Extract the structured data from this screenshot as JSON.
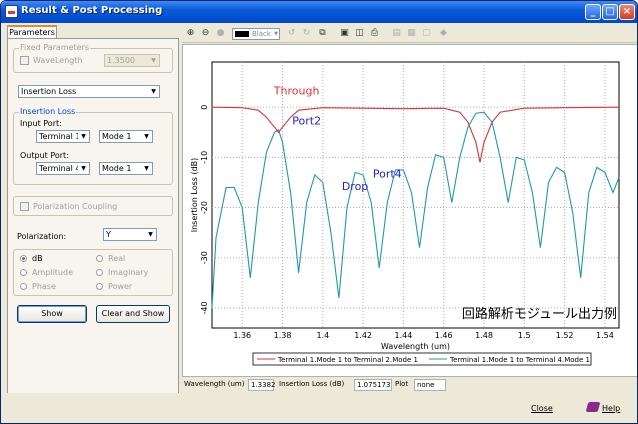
{
  "window": {
    "title": "Result & Post Processing",
    "controls": [
      "_",
      "□",
      "×"
    ]
  },
  "tabs": [
    "Parameters"
  ],
  "fixed_parameters": {
    "group_label": "Fixed Parameters",
    "wavelength_label": "WaveLength",
    "wavelength_value": "1.3500",
    "result_type": "Insertion Loss"
  },
  "insertion_loss": {
    "group_label": "Insertion Loss",
    "input_port_label": "Input Port:",
    "input_terminal": "Terminal 1",
    "input_mode": "Mode 1",
    "output_port_label": "Output Port:",
    "output_terminal": "Terminal 4",
    "output_mode": "Mode 1"
  },
  "polarization_coupling_label": "Polarization Coupling",
  "polarization": {
    "label": "Polarization:",
    "value": "Y"
  },
  "units": {
    "left": [
      "dB",
      "Amplitude",
      "Phase"
    ],
    "right": [
      "Real",
      "Imaginary",
      "Power"
    ],
    "selected": "dB"
  },
  "buttons": {
    "show": "Show",
    "clear_show": "Clear and Show",
    "close": "Close",
    "help": "Help"
  },
  "toolbar": {
    "color_label": "Black"
  },
  "status": {
    "wavelength_label": "Wavelength (um)",
    "wavelength_value": "1.3382",
    "loss_label": "Insertion Loss (dB)",
    "loss_value": "1.075173",
    "plot_label": "Plot",
    "plot_value": "none"
  },
  "colors": {
    "through": "#dd3333",
    "drop": "#1f9aa8",
    "label_blue": "#2222cc",
    "accent": "#0a5ad8"
  },
  "chart_data": {
    "type": "line",
    "xlabel": "Wavelength (um)",
    "ylabel": "Insertion Loss (dB)",
    "xlim": [
      1.345,
      1.547
    ],
    "ylim": [
      -44,
      9
    ],
    "xticks": [
      1.36,
      1.38,
      1.4,
      1.42,
      1.44,
      1.46,
      1.48,
      1.5,
      1.52,
      1.54
    ],
    "yticks": [
      0,
      -10,
      -20,
      -30,
      -40
    ],
    "grid": true,
    "legend_position": "bottom",
    "annotations": [
      "Through",
      "Port2",
      "Port4",
      "Drop",
      "回路解析モジュール出力例"
    ],
    "series": [
      {
        "name": "Terminal 1.Mode 1 to Terminal 2.Mode 1",
        "color": "#dd3333",
        "x": [
          1.345,
          1.36,
          1.368,
          1.372,
          1.376,
          1.378,
          1.38,
          1.384,
          1.388,
          1.4,
          1.42,
          1.44,
          1.46,
          1.468,
          1.472,
          1.476,
          1.478,
          1.48,
          1.484,
          1.488,
          1.5,
          1.52,
          1.547
        ],
        "y": [
          0,
          -0.1,
          -0.6,
          -2,
          -4,
          -5,
          -4,
          -2,
          -0.6,
          -0.1,
          -0.2,
          -0.3,
          -0.2,
          -1,
          -3,
          -7,
          -11,
          -7,
          -3,
          -1,
          -0.2,
          -0.1,
          0
        ]
      },
      {
        "name": "Terminal 1.Mode 1 to Terminal 4.Mode 1",
        "color": "#1f9aa8",
        "x": [
          1.345,
          1.347,
          1.352,
          1.356,
          1.36,
          1.364,
          1.368,
          1.372,
          1.376,
          1.378,
          1.38,
          1.384,
          1.388,
          1.392,
          1.396,
          1.4,
          1.404,
          1.408,
          1.412,
          1.416,
          1.42,
          1.424,
          1.428,
          1.432,
          1.436,
          1.44,
          1.444,
          1.448,
          1.452,
          1.456,
          1.46,
          1.464,
          1.468,
          1.472,
          1.476,
          1.48,
          1.484,
          1.488,
          1.492,
          1.496,
          1.5,
          1.504,
          1.508,
          1.512,
          1.516,
          1.52,
          1.524,
          1.528,
          1.532,
          1.536,
          1.54,
          1.544,
          1.547
        ],
        "y": [
          -40,
          -26,
          -16,
          -16,
          -20,
          -34,
          -19,
          -9,
          -5,
          -4.5,
          -7,
          -17,
          -33,
          -19,
          -13.5,
          -15,
          -25,
          -38,
          -20,
          -13,
          -13.5,
          -19,
          -32,
          -19,
          -12.5,
          -12.5,
          -17,
          -28,
          -16,
          -9.5,
          -10,
          -19,
          -10,
          -4,
          -1.2,
          -1,
          -3,
          -10,
          -19,
          -10,
          -10.5,
          -17,
          -28,
          -15,
          -12,
          -13,
          -21,
          -34,
          -17,
          -12,
          -13,
          -17,
          -14
        ]
      }
    ]
  }
}
